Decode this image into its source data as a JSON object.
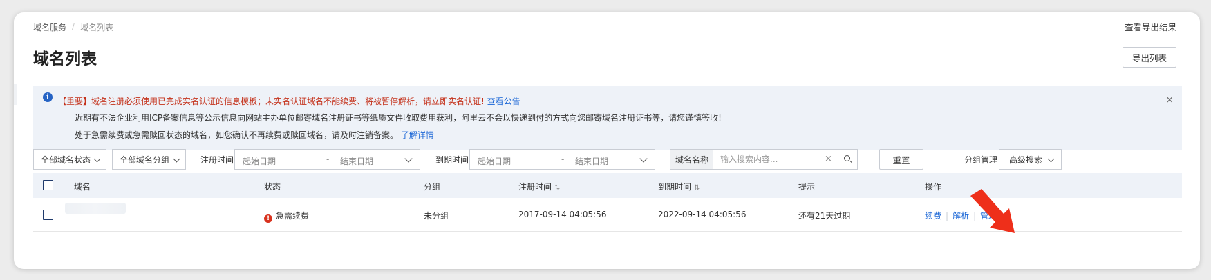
{
  "breadcrumb": {
    "root": "域名服务",
    "separator": "/",
    "current": "域名列表"
  },
  "header": {
    "title": "域名列表",
    "export_result_link": "查看导出结果",
    "export_list_button": "导出列表"
  },
  "notice": {
    "line1_prefix": "【重要】域名注册必须使用已完成实名认证的信息模板；未实名认证域名不能续费、将被暂停解析，请立即实名认证!",
    "line1_link": "查看公告",
    "line2": "近期有不法企业利用ICP备案信息等公示信息向网站主办单位邮寄域名注册证书等纸质文件收取费用获利，阿里云不会以快递到付的方式向您邮寄域名注册证书等，请您谨慎签收!",
    "line3_prefix": "处于急需续费或急需赎回状态的域名，如您确认不再续费或赎回域名，请及时注销备案。",
    "line3_link": "了解详情",
    "close": "×",
    "info_icon": "info-icon"
  },
  "filters": {
    "status_select": "全部域名状态",
    "group_select": "全部域名分组",
    "reg_time_label": "注册时间",
    "reg_start": "起始日期",
    "reg_end": "结束日期",
    "exp_time_label": "到期时间",
    "exp_start": "起始日期",
    "exp_end": "结束日期",
    "date_dash": "-",
    "search_prefix": "域名名称",
    "search_placeholder": "输入搜索内容...",
    "clear": "×",
    "reset_button": "重置",
    "group_manage": "分组管理",
    "advanced_search": "高级搜索"
  },
  "table": {
    "headers": {
      "domain": "域名",
      "status": "状态",
      "group": "分组",
      "reg_time": "注册时间",
      "exp_time": "到期时间",
      "hint": "提示",
      "actions": "操作",
      "sort_glyph": "⇅"
    },
    "rows": [
      {
        "status": "急需续费",
        "status_icon": "!",
        "group": "未分组",
        "reg_time": "2017-09-14 04:05:56",
        "exp_time": "2022-09-14 04:05:56",
        "hint": "还有21天过期",
        "actions": [
          "续费",
          "解析",
          "管理"
        ],
        "action_separator": "|"
      }
    ]
  },
  "colors": {
    "accent": "#1a66d6",
    "danger": "#d8321e",
    "notice_bg": "#eef2f8",
    "arrow": "#ee2f1a"
  }
}
